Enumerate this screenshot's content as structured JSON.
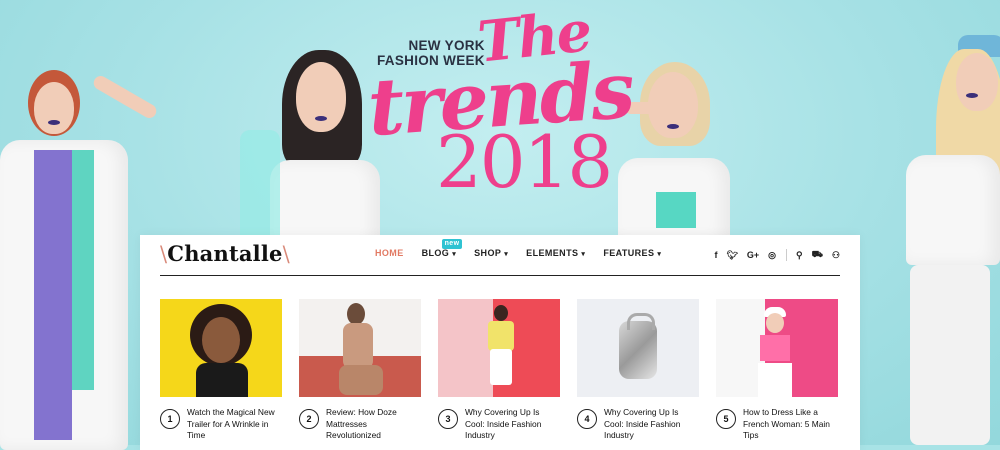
{
  "hero": {
    "event_line1": "NEW YORK",
    "event_line2": "FASHION WEEK",
    "script_the": "The",
    "script_trends": "trends",
    "script_year": "2018",
    "bg_color": "#a8e3e6",
    "accent_color": "#ee3f8c"
  },
  "site": {
    "logo_text": "Chantalle",
    "nav": [
      {
        "label": "HOME",
        "active": true
      },
      {
        "label": "BLOG",
        "badge": "new"
      },
      {
        "label": "SHOP"
      },
      {
        "label": "ELEMENTS"
      },
      {
        "label": "FEATURES"
      }
    ],
    "social_icons": [
      "facebook-icon",
      "twitter-icon",
      "google-plus-icon",
      "instagram-icon"
    ],
    "utility_icons": [
      "search-icon",
      "cart-icon",
      "user-icon"
    ],
    "posts": [
      {
        "num": "1",
        "title": "Watch the Magical New Trailer for A Wrinkle in Time"
      },
      {
        "num": "2",
        "title": "Review: How Doze Mattresses Revolutionized"
      },
      {
        "num": "3",
        "title": "Why Covering Up Is Cool: Inside Fashion Industry"
      },
      {
        "num": "4",
        "title": "Why Covering Up Is Cool: Inside Fashion Industry"
      },
      {
        "num": "5",
        "title": "How to Dress Like a French Woman: 5 Main Tips"
      }
    ]
  }
}
